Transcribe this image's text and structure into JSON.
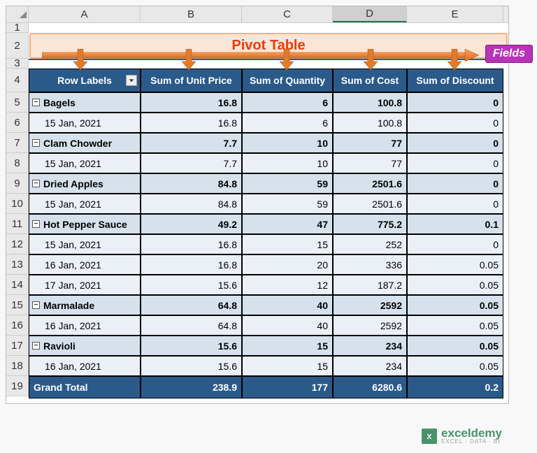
{
  "columns": [
    "A",
    "B",
    "C",
    "D",
    "E"
  ],
  "row_nums": [
    1,
    2,
    3,
    4,
    5,
    6,
    7,
    8,
    9,
    10,
    11,
    12,
    13,
    14,
    15,
    16,
    17,
    18,
    19
  ],
  "title": "Pivot Table",
  "fields_label": "Fields",
  "headers": {
    "row_labels": "Row Labels",
    "unit_price": "Sum of Unit Price",
    "quantity": "Sum of Quantity",
    "cost": "Sum of Cost",
    "discount": "Sum of Discount"
  },
  "groups": [
    {
      "label": "Bagels",
      "up": "16.8",
      "qty": "6",
      "cost": "100.8",
      "disc": "0",
      "rows": [
        {
          "label": "15 Jan, 2021",
          "up": "16.8",
          "qty": "6",
          "cost": "100.8",
          "disc": "0"
        }
      ]
    },
    {
      "label": "Clam Chowder",
      "up": "7.7",
      "qty": "10",
      "cost": "77",
      "disc": "0",
      "rows": [
        {
          "label": "15 Jan, 2021",
          "up": "7.7",
          "qty": "10",
          "cost": "77",
          "disc": "0"
        }
      ]
    },
    {
      "label": "Dried Apples",
      "up": "84.8",
      "qty": "59",
      "cost": "2501.6",
      "disc": "0",
      "rows": [
        {
          "label": "15 Jan, 2021",
          "up": "84.8",
          "qty": "59",
          "cost": "2501.6",
          "disc": "0"
        }
      ]
    },
    {
      "label": "Hot Pepper Sauce",
      "up": "49.2",
      "qty": "47",
      "cost": "775.2",
      "disc": "0.1",
      "rows": [
        {
          "label": "15 Jan, 2021",
          "up": "16.8",
          "qty": "15",
          "cost": "252",
          "disc": "0"
        },
        {
          "label": "16 Jan, 2021",
          "up": "16.8",
          "qty": "20",
          "cost": "336",
          "disc": "0.05"
        },
        {
          "label": "17 Jan, 2021",
          "up": "15.6",
          "qty": "12",
          "cost": "187.2",
          "disc": "0.05"
        }
      ]
    },
    {
      "label": "Marmalade",
      "up": "64.8",
      "qty": "40",
      "cost": "2592",
      "disc": "0.05",
      "rows": [
        {
          "label": "16 Jan, 2021",
          "up": "64.8",
          "qty": "40",
          "cost": "2592",
          "disc": "0.05"
        }
      ]
    },
    {
      "label": "Ravioli",
      "up": "15.6",
      "qty": "15",
      "cost": "234",
      "disc": "0.05",
      "rows": [
        {
          "label": "16 Jan, 2021",
          "up": "15.6",
          "qty": "15",
          "cost": "234",
          "disc": "0.05"
        }
      ]
    }
  ],
  "grand_total": {
    "label": "Grand Total",
    "up": "238.9",
    "qty": "177",
    "cost": "6280.6",
    "disc": "0.2"
  },
  "watermark": {
    "brand": "exceldemy",
    "tag": "EXCEL · DATA · BI"
  },
  "chart_data": {
    "type": "table",
    "title": "Pivot Table",
    "columns": [
      "Row Labels",
      "Sum of Unit Price",
      "Sum of Quantity",
      "Sum of Cost",
      "Sum of Discount"
    ],
    "categories": [
      "Bagels",
      "Clam Chowder",
      "Dried Apples",
      "Hot Pepper Sauce",
      "Marmalade",
      "Ravioli"
    ],
    "series": [
      {
        "name": "Sum of Unit Price",
        "values": [
          16.8,
          7.7,
          84.8,
          49.2,
          64.8,
          15.6
        ]
      },
      {
        "name": "Sum of Quantity",
        "values": [
          6,
          10,
          59,
          47,
          40,
          15
        ]
      },
      {
        "name": "Sum of Cost",
        "values": [
          100.8,
          77,
          2501.6,
          775.2,
          2592,
          234
        ]
      },
      {
        "name": "Sum of Discount",
        "values": [
          0,
          0,
          0,
          0.1,
          0.05,
          0.05
        ]
      }
    ],
    "totals": {
      "Sum of Unit Price": 238.9,
      "Sum of Quantity": 177,
      "Sum of Cost": 6280.6,
      "Sum of Discount": 0.2
    }
  }
}
